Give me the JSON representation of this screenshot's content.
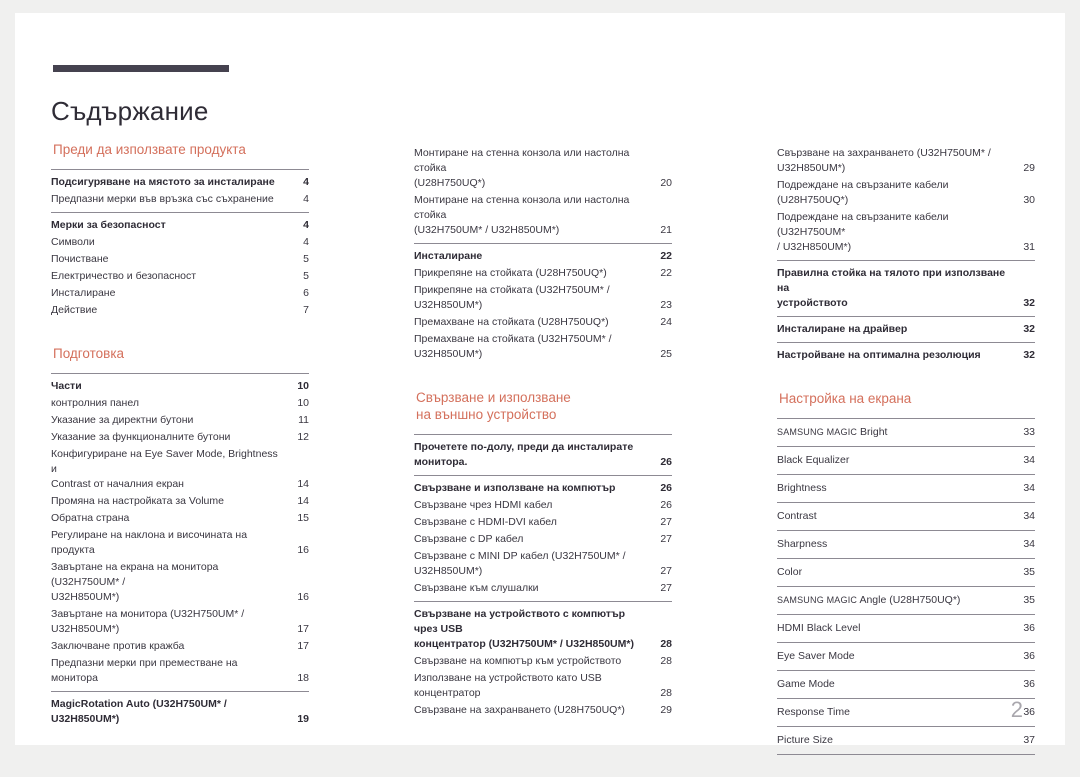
{
  "document": {
    "title": "Съдържание",
    "page_number": "2",
    "accent_color": "#d4705c",
    "rule_color": "#45424f"
  },
  "columns": [
    {
      "sections": [
        {
          "heading": "Преди да използвате продукта",
          "groups": [
            {
              "rows": [
                {
                  "label": "Подсигуряване на мястото за инсталиране",
                  "page": "4",
                  "bold": true
                },
                {
                  "label": "Предпазни мерки във връзка със съхранение",
                  "page": "4",
                  "bold": false
                }
              ]
            },
            {
              "rows": [
                {
                  "label": "Мерки за безопасност",
                  "page": "4",
                  "bold": true
                },
                {
                  "label": "Символи",
                  "page": "4",
                  "bold": false
                },
                {
                  "label": "Почистване",
                  "page": "5",
                  "bold": false
                },
                {
                  "label": "Електричество и безопасност",
                  "page": "5",
                  "bold": false
                },
                {
                  "label": "Инсталиране",
                  "page": "6",
                  "bold": false
                },
                {
                  "label": "Действие",
                  "page": "7",
                  "bold": false
                }
              ]
            }
          ]
        },
        {
          "heading": "Подготовка",
          "groups": [
            {
              "rows": [
                {
                  "label": "Части",
                  "page": "10",
                  "bold": true
                },
                {
                  "label": "контролния панел",
                  "page": "10",
                  "bold": false
                },
                {
                  "label": "Указание за директни бутони",
                  "page": "11",
                  "bold": false
                },
                {
                  "label": "Указание за функционалните бутони",
                  "page": "12",
                  "bold": false
                },
                {
                  "label": "Конфигуриране на Eye Saver Mode, Brightness и\nContrast от началния екран",
                  "page": "14",
                  "bold": false
                },
                {
                  "label": "Промяна на настройката за Volume",
                  "page": "14",
                  "bold": false
                },
                {
                  "label": "Обратна страна",
                  "page": "15",
                  "bold": false
                },
                {
                  "label": "Регулиране на наклона и височината на\nпродукта",
                  "page": "16",
                  "bold": false
                },
                {
                  "label": "Завъртане на екрана на монитора (U32H750UM* /\nU32H850UM*)",
                  "page": "16",
                  "bold": false
                },
                {
                  "label": "Завъртане на монитора (U32H750UM* /\nU32H850UM*)",
                  "page": "17",
                  "bold": false
                },
                {
                  "label": "Заключване против кражба",
                  "page": "17",
                  "bold": false
                },
                {
                  "label": "Предпазни мерки при преместване на\nмонитора",
                  "page": "18",
                  "bold": false
                }
              ]
            },
            {
              "rows": [
                {
                  "label": "MagicRotation Auto (U32H750UM* /\nU32H850UM*)",
                  "page": "19",
                  "bold": true
                }
              ]
            }
          ]
        }
      ]
    },
    {
      "sections": [
        {
          "heading": "",
          "groups": [
            {
              "no_rule": true,
              "rows": [
                {
                  "label": "Монтиране на стенна конзола или настолна стойка\n(U28H750UQ*)",
                  "page": "20",
                  "bold": false
                },
                {
                  "label": "Монтиране на стенна конзола или настолна стойка\n(U32H750UM* / U32H850UM*)",
                  "page": "21",
                  "bold": false
                }
              ]
            },
            {
              "rows": [
                {
                  "label": "Инсталиране",
                  "page": "22",
                  "bold": true
                },
                {
                  "label": "Прикрепяне на стойката (U28H750UQ*)",
                  "page": "22",
                  "bold": false
                },
                {
                  "label": "Прикрепяне на стойката (U32H750UM* /\nU32H850UM*)",
                  "page": "23",
                  "bold": false
                },
                {
                  "label": "Премахване на стойката (U28H750UQ*)",
                  "page": "24",
                  "bold": false
                },
                {
                  "label": "Премахване на стойката (U32H750UM* /\nU32H850UM*)",
                  "page": "25",
                  "bold": false
                }
              ]
            }
          ]
        },
        {
          "heading": "Свързване и използване\nна външно устройство",
          "groups": [
            {
              "rows": [
                {
                  "label": "Прочетете по-долу, преди да инсталирате\nмонитора.",
                  "page": "26",
                  "bold": true
                }
              ]
            },
            {
              "rows": [
                {
                  "label": "Свързване и използване на компютър",
                  "page": "26",
                  "bold": true
                },
                {
                  "label": "Свързване чрез HDMI кабел",
                  "page": "26",
                  "bold": false
                },
                {
                  "label": "Свързване с HDMI-DVI кабел",
                  "page": "27",
                  "bold": false
                },
                {
                  "label": "Свързване с DP кабел",
                  "page": "27",
                  "bold": false
                },
                {
                  "label": "Свързване с MINI DP кабел (U32H750UM* /\nU32H850UM*)",
                  "page": "27",
                  "bold": false
                },
                {
                  "label": "Свързване към слушалки",
                  "page": "27",
                  "bold": false
                }
              ]
            },
            {
              "rows": [
                {
                  "label": "Свързване на устройството с компютър чрез USB\nконцентратор (U32H750UM* / U32H850UM*)",
                  "page": "28",
                  "bold": true
                },
                {
                  "label": "Свързване на компютър към устройството",
                  "page": "28",
                  "bold": false
                },
                {
                  "label": "Използване на устройството като USB\nконцентратор",
                  "page": "28",
                  "bold": false
                },
                {
                  "label": "Свързване на захранването (U28H750UQ*)",
                  "page": "29",
                  "bold": false
                }
              ]
            }
          ]
        }
      ]
    },
    {
      "sections": [
        {
          "heading": "",
          "groups": [
            {
              "no_rule": true,
              "rows": [
                {
                  "label": "Свързване на захранването (U32H750UM* /\nU32H850UM*)",
                  "page": "29",
                  "bold": false
                },
                {
                  "label": "Подреждане на свързаните кабели\n(U28H750UQ*)",
                  "page": "30",
                  "bold": false
                },
                {
                  "label": "Подреждане на свързаните кабели (U32H750UM*\n/ U32H850UM*)",
                  "page": "31",
                  "bold": false
                }
              ]
            },
            {
              "rows": [
                {
                  "label": "Правилна стойка на тялото при използване на\nустройството",
                  "page": "32",
                  "bold": true
                }
              ]
            },
            {
              "rows": [
                {
                  "label": "Инсталиране на драйвер",
                  "page": "32",
                  "bold": true
                }
              ]
            },
            {
              "rows": [
                {
                  "label": "Настройване на оптимална резолюция",
                  "page": "32",
                  "bold": true
                }
              ]
            }
          ]
        },
        {
          "heading": "Настройка на екрана",
          "bands": [
            {
              "label_prefix": "SAMSUNG MAGIC",
              "label": " Bright",
              "page": "33"
            },
            {
              "label_prefix": "",
              "label": "Black Equalizer",
              "page": "34"
            },
            {
              "label_prefix": "",
              "label": "Brightness",
              "page": "34"
            },
            {
              "label_prefix": "",
              "label": "Contrast",
              "page": "34"
            },
            {
              "label_prefix": "",
              "label": "Sharpness",
              "page": "34"
            },
            {
              "label_prefix": "",
              "label": "Color",
              "page": "35"
            },
            {
              "label_prefix": "SAMSUNG MAGIC",
              "label": " Angle (U28H750UQ*)",
              "page": "35"
            },
            {
              "label_prefix": "",
              "label": "HDMI Black Level",
              "page": "36"
            },
            {
              "label_prefix": "",
              "label": "Eye Saver Mode",
              "page": "36"
            },
            {
              "label_prefix": "",
              "label": "Game Mode",
              "page": "36"
            },
            {
              "label_prefix": "",
              "label": "Response Time",
              "page": "36"
            },
            {
              "label_prefix": "",
              "label": "Picture Size",
              "page": "37"
            }
          ]
        }
      ]
    }
  ]
}
